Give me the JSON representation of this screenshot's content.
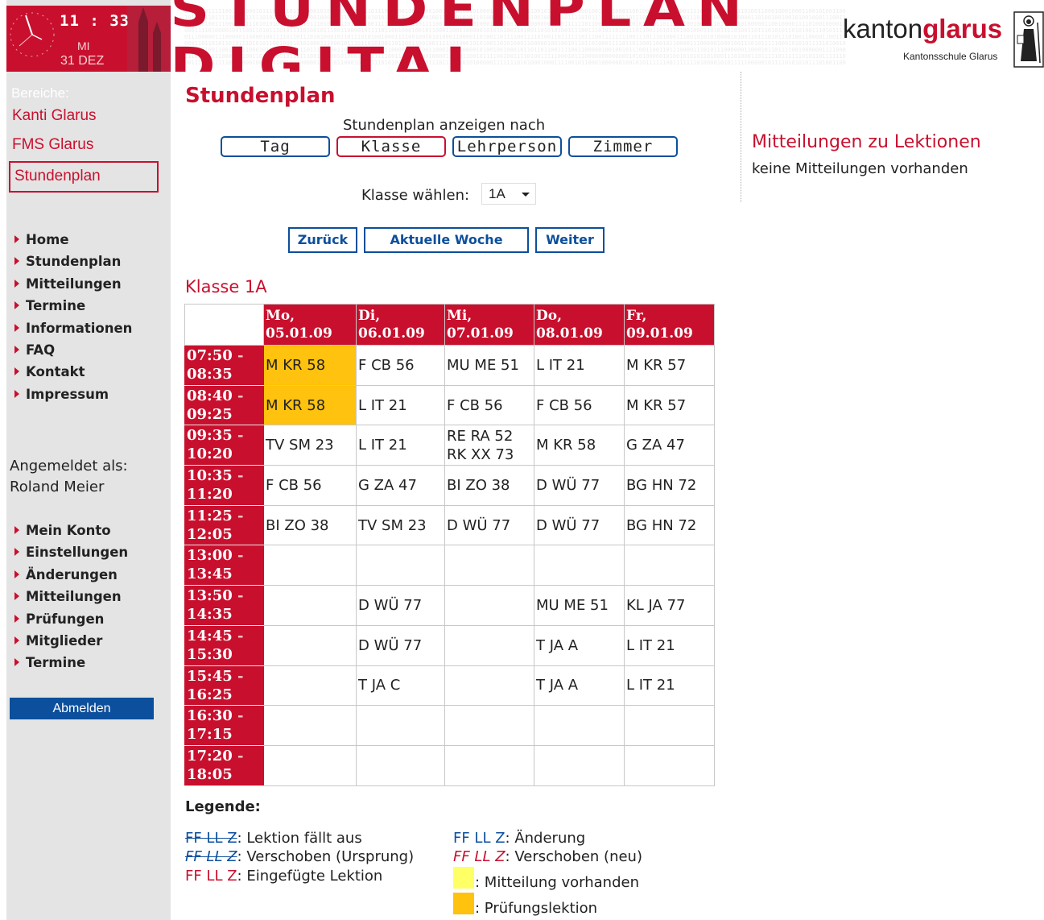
{
  "clock": {
    "time": "11 : 33",
    "weekday": "MI",
    "date": "31 DEZ"
  },
  "banner": {
    "title": "STUNDENPLAN DIGITAL",
    "brand_kanton": "kanton",
    "brand_glarus": "glarus",
    "brand_school": "Kantonsschule Glarus"
  },
  "sidebar": {
    "areas_heading": "Bereiche:",
    "areas": [
      "Kanti Glarus",
      "FMS Glarus",
      "Stundenplan"
    ],
    "nav_main": [
      "Home",
      "Stundenplan",
      "Mitteilungen",
      "Termine",
      "Informationen",
      "FAQ",
      "Kontakt",
      "Impressum"
    ],
    "logged_in_label": "Angemeldet als:",
    "logged_in_name": "Roland Meier",
    "nav_user": [
      "Mein Konto",
      "Einstellungen",
      "Änderungen",
      "Mitteilungen",
      "Prüfungen",
      "Mitglieder",
      "Termine"
    ],
    "logout": "Abmelden"
  },
  "main": {
    "title": "Stundenplan",
    "view_by_label": "Stundenplan anzeigen nach",
    "view_buttons": [
      "Tag",
      "Klasse",
      "Lehrperson",
      "Zimmer"
    ],
    "class_select_label": "Klasse wählen:",
    "class_select_value": "1A",
    "week_buttons": {
      "back": "Zurück",
      "current": "Aktuelle Woche",
      "next": "Weiter"
    },
    "class_heading": "Klasse 1A"
  },
  "timetable": {
    "days": [
      {
        "name": "Mo,",
        "date": "05.01.09"
      },
      {
        "name": "Di,",
        "date": "06.01.09"
      },
      {
        "name": "Mi,",
        "date": "07.01.09"
      },
      {
        "name": "Do,",
        "date": "08.01.09"
      },
      {
        "name": "Fr,",
        "date": "09.01.09"
      }
    ],
    "slots": [
      {
        "start": "07:50",
        "end": "08:35",
        "cells": [
          {
            "lines": [
              "M KR 58"
            ],
            "exam": true
          },
          {
            "lines": [
              "F CB 56"
            ]
          },
          {
            "lines": [
              "MU ME 51"
            ]
          },
          {
            "lines": [
              "L IT 21"
            ]
          },
          {
            "lines": [
              "M KR 57"
            ]
          }
        ]
      },
      {
        "start": "08:40",
        "end": "09:25",
        "cells": [
          {
            "lines": [
              "M KR 58"
            ],
            "exam": true
          },
          {
            "lines": [
              "L IT 21"
            ]
          },
          {
            "lines": [
              "F CB 56"
            ]
          },
          {
            "lines": [
              "F CB 56"
            ]
          },
          {
            "lines": [
              "M KR 57"
            ]
          }
        ]
      },
      {
        "start": "09:35",
        "end": "10:20",
        "cells": [
          {
            "lines": [
              "TV SM 23"
            ]
          },
          {
            "lines": [
              "L IT 21"
            ]
          },
          {
            "lines": [
              "RE RA 52",
              "RK XX 73"
            ]
          },
          {
            "lines": [
              "M KR 58"
            ]
          },
          {
            "lines": [
              "G ZA 47"
            ]
          }
        ]
      },
      {
        "start": "10:35",
        "end": "11:20",
        "cells": [
          {
            "lines": [
              "F CB 56"
            ]
          },
          {
            "lines": [
              "G ZA 47"
            ]
          },
          {
            "lines": [
              "BI ZO 38"
            ]
          },
          {
            "lines": [
              "D WÜ 77"
            ]
          },
          {
            "lines": [
              "BG HN 72"
            ]
          }
        ]
      },
      {
        "start": "11:25",
        "end": "12:05",
        "cells": [
          {
            "lines": [
              "BI ZO 38"
            ]
          },
          {
            "lines": [
              "TV SM 23"
            ]
          },
          {
            "lines": [
              "D WÜ 77"
            ]
          },
          {
            "lines": [
              "D WÜ 77"
            ]
          },
          {
            "lines": [
              "BG HN 72"
            ]
          }
        ]
      },
      {
        "start": "13:00",
        "end": "13:45",
        "cells": [
          {
            "lines": []
          },
          {
            "lines": []
          },
          {
            "lines": []
          },
          {
            "lines": []
          },
          {
            "lines": []
          }
        ]
      },
      {
        "start": "13:50",
        "end": "14:35",
        "cells": [
          {
            "lines": []
          },
          {
            "lines": [
              "D WÜ 77"
            ]
          },
          {
            "lines": []
          },
          {
            "lines": [
              "MU ME 51"
            ]
          },
          {
            "lines": [
              "KL JA 77"
            ]
          }
        ]
      },
      {
        "start": "14:45",
        "end": "15:30",
        "cells": [
          {
            "lines": []
          },
          {
            "lines": [
              "D WÜ 77"
            ]
          },
          {
            "lines": []
          },
          {
            "lines": [
              "T JA A"
            ]
          },
          {
            "lines": [
              "L IT 21"
            ]
          }
        ]
      },
      {
        "start": "15:45",
        "end": "16:25",
        "cells": [
          {
            "lines": []
          },
          {
            "lines": [
              "T JA C"
            ]
          },
          {
            "lines": []
          },
          {
            "lines": [
              "T JA A"
            ]
          },
          {
            "lines": [
              "L IT 21"
            ]
          }
        ]
      },
      {
        "start": "16:30",
        "end": "17:15",
        "cells": [
          {
            "lines": []
          },
          {
            "lines": []
          },
          {
            "lines": []
          },
          {
            "lines": []
          },
          {
            "lines": []
          }
        ]
      },
      {
        "start": "17:20",
        "end": "18:05",
        "cells": [
          {
            "lines": []
          },
          {
            "lines": []
          },
          {
            "lines": []
          },
          {
            "lines": []
          },
          {
            "lines": []
          }
        ]
      }
    ]
  },
  "legend": {
    "title": "Legende:",
    "code": "FF LL Z",
    "cancelled": ": Lektion fällt aus",
    "moved_origin": ": Verschoben (Ursprung)",
    "inserted": ": Eingefügte Lektion",
    "changed": ": Änderung",
    "moved_new": ": Verschoben (neu)",
    "has_message": ": Mitteilung vorhanden",
    "exam": ": Prüfungslektion"
  },
  "messages": {
    "heading": "Mitteilungen zu Lektionen",
    "text": "keine Mitteilungen vorhanden"
  },
  "colors": {
    "accent_red": "#c8102e",
    "accent_blue": "#0c4f9c",
    "exam": "#ffc20e",
    "message": "#ffff66",
    "sidebar_bg": "#e4e4e4"
  }
}
